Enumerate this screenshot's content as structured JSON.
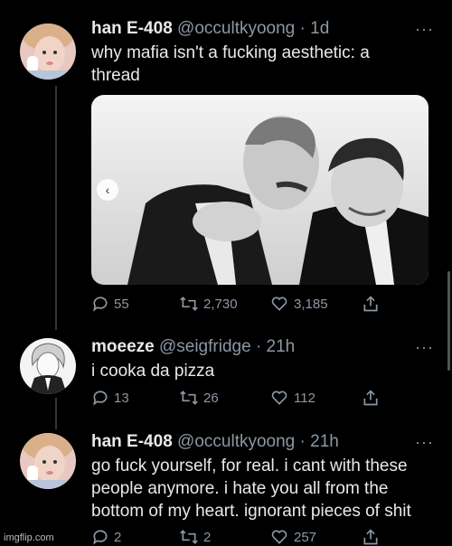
{
  "tweets": [
    {
      "name": "han E-408",
      "handle": "@occultkyoong",
      "time": "· 1d",
      "more": "···",
      "text": "why mafia isn't a fucking aesthetic: a thread",
      "replies": "55",
      "retweets": "2,730",
      "likes": "3,185"
    },
    {
      "name": "moeeze",
      "handle": "@seigfridge",
      "time": "· 21h",
      "more": "···",
      "text": "i cooka da pizza",
      "replies": "13",
      "retweets": "26",
      "likes": "112"
    },
    {
      "name": "han E-408",
      "handle": "@occultkyoong",
      "time": "· 21h",
      "more": "···",
      "text": "go fuck yourself, for real. i cant with these people anymore. i hate you all from the bottom of my heart. ignorant pieces of shit",
      "replies": "2",
      "retweets": "2",
      "likes": "257"
    }
  ],
  "media": {
    "nav_icon": "chevron-left-icon",
    "nav_glyph": "‹"
  },
  "watermark": "imgflip.com",
  "colors": {
    "background": "#000000",
    "text": "#e7e9ea",
    "muted": "#8b98a5"
  }
}
